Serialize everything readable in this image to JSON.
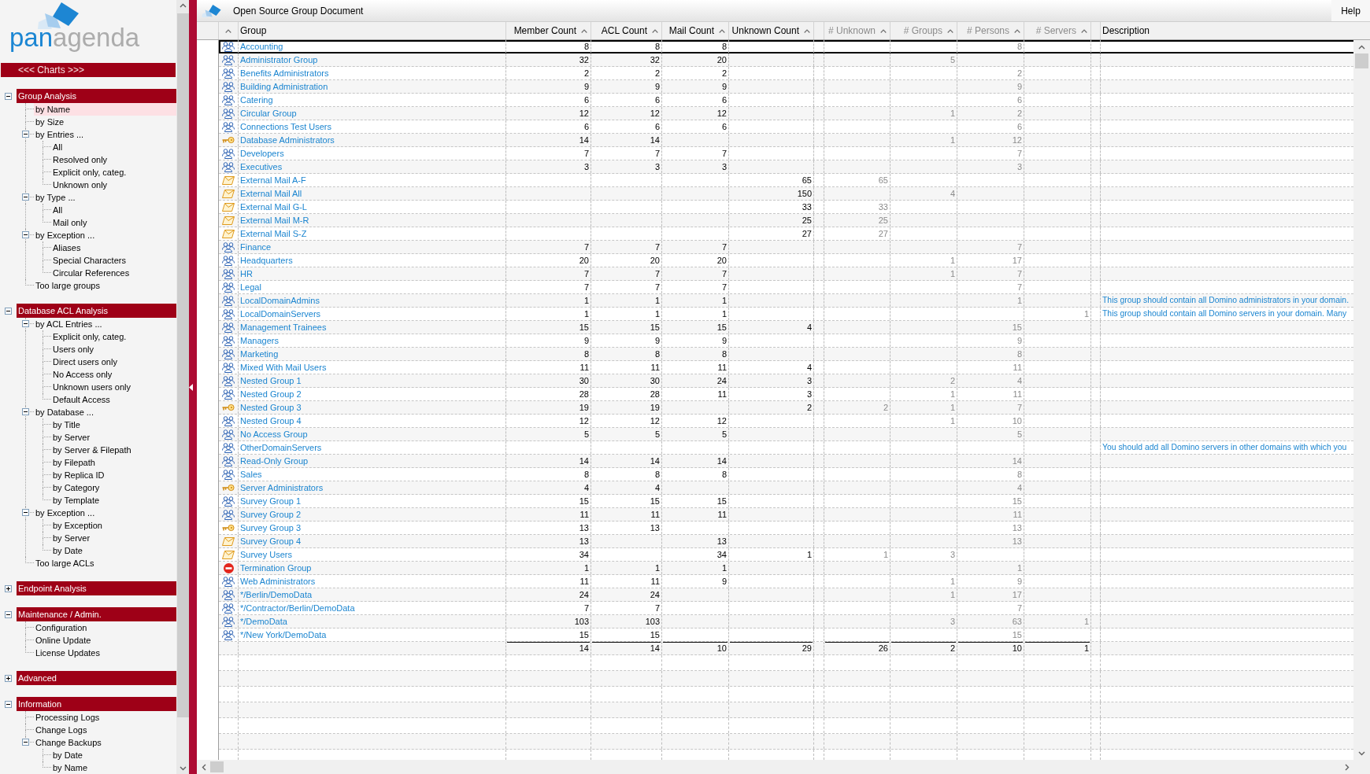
{
  "sidebar": {
    "logo": {
      "parts": [
        {
          "text": "pan",
          "color": "#1b86d3"
        },
        {
          "text": "agenda",
          "color": "#acacac"
        }
      ]
    },
    "charts_button": "<<< Charts >>>",
    "sections": [
      {
        "title": "Group Analysis",
        "expanded": true,
        "items": [
          {
            "label": "by Name",
            "selected": true
          },
          {
            "label": "by Size",
            "selected": false
          },
          {
            "label": "by Entries ...",
            "selected": false,
            "expanded": true,
            "children": [
              {
                "label": "All",
                "selected": false
              },
              {
                "label": "Resolved only",
                "selected": false
              },
              {
                "label": "Explicit only, categ.",
                "selected": false
              },
              {
                "label": "Unknown only",
                "selected": false
              }
            ]
          },
          {
            "label": "by Type ...",
            "selected": false,
            "expanded": true,
            "children": [
              {
                "label": "All",
                "selected": false
              },
              {
                "label": "Mail only",
                "selected": false
              }
            ]
          },
          {
            "label": "by Exception ...",
            "selected": false,
            "expanded": true,
            "children": [
              {
                "label": "Aliases",
                "selected": false
              },
              {
                "label": "Special Characters",
                "selected": false
              },
              {
                "label": "Circular References",
                "selected": false
              }
            ]
          },
          {
            "label": "Too large groups",
            "selected": false
          }
        ]
      },
      {
        "title": "Database ACL Analysis",
        "expanded": true,
        "items": [
          {
            "label": "by ACL Entries ...",
            "selected": false,
            "expanded": true,
            "children": [
              {
                "label": "Explicit only, categ.",
                "selected": false
              },
              {
                "label": "Users only",
                "selected": false
              },
              {
                "label": "Direct users only",
                "selected": false
              },
              {
                "label": "No Access only",
                "selected": false
              },
              {
                "label": "Unknown users only",
                "selected": false
              },
              {
                "label": "Default Access",
                "selected": false
              }
            ]
          },
          {
            "label": "by Database ...",
            "selected": false,
            "expanded": true,
            "children": [
              {
                "label": "by Title",
                "selected": false
              },
              {
                "label": "by Server",
                "selected": false
              },
              {
                "label": "by Server & Filepath",
                "selected": false
              },
              {
                "label": "by Filepath",
                "selected": false
              },
              {
                "label": "by Replica ID",
                "selected": false
              },
              {
                "label": "by Category",
                "selected": false
              },
              {
                "label": "by Template",
                "selected": false
              }
            ]
          },
          {
            "label": "by Exception ...",
            "selected": false,
            "expanded": true,
            "children": [
              {
                "label": "by Exception",
                "selected": false
              },
              {
                "label": "by Server",
                "selected": false
              },
              {
                "label": "by Date",
                "selected": false
              }
            ]
          },
          {
            "label": "Too large ACLs",
            "selected": false
          }
        ]
      },
      {
        "title": "Endpoint Analysis",
        "expanded": false
      },
      {
        "title": "Maintenance / Admin.",
        "expanded": true,
        "items": [
          {
            "label": "Configuration",
            "selected": false
          },
          {
            "label": "Online Update",
            "selected": false
          },
          {
            "label": "License Updates",
            "selected": false
          }
        ]
      },
      {
        "title": "Advanced",
        "expanded": false
      },
      {
        "title": "Information",
        "expanded": true,
        "items": [
          {
            "label": "Processing Logs",
            "selected": false
          },
          {
            "label": "Change Logs",
            "selected": false
          },
          {
            "label": "Change Backups",
            "selected": false,
            "expanded": true,
            "children": [
              {
                "label": "by Date",
                "selected": false
              },
              {
                "label": "by Name",
                "selected": false
              }
            ]
          }
        ]
      }
    ]
  },
  "window": {
    "title": "Open Source Group Document",
    "help_button": "Help"
  },
  "table": {
    "columns": [
      {
        "kind": "icon",
        "sortable": true
      },
      {
        "kind": "name",
        "label": "Group",
        "sortable": false
      },
      {
        "kind": "count",
        "label": "Member Count",
        "sortable": true
      },
      {
        "kind": "count",
        "label": "ACL Count",
        "sortable": true
      },
      {
        "kind": "count",
        "label": "Mail Count",
        "sortable": true
      },
      {
        "kind": "count",
        "label": "Unknown Count",
        "sortable": true
      },
      {
        "kind": "count_muted",
        "label": "# Unknown",
        "sortable": true
      },
      {
        "kind": "count_muted",
        "label": "# Groups",
        "sortable": true
      },
      {
        "kind": "count_muted",
        "label": "# Persons",
        "sortable": true
      },
      {
        "kind": "count_muted",
        "label": "# Servers",
        "sortable": true
      },
      {
        "kind": "text",
        "label": "Description",
        "sortable": false
      }
    ],
    "rows": [
      {
        "kind": "multi_purpose",
        "name": "Accounting",
        "member_count": "8",
        "acl_count": "8",
        "mail_count": "8",
        "persons": "8",
        "selected": true
      },
      {
        "kind": "multi_purpose",
        "name": "Administrator Group",
        "member_count": "32",
        "acl_count": "32",
        "mail_count": "20",
        "groups": "5",
        "selected": false
      },
      {
        "kind": "multi_purpose",
        "name": "Benefits Administrators",
        "member_count": "2",
        "acl_count": "2",
        "mail_count": "2",
        "persons": "2",
        "selected": false
      },
      {
        "kind": "multi_purpose",
        "name": "Building Administration",
        "member_count": "9",
        "acl_count": "9",
        "mail_count": "9",
        "persons": "9",
        "selected": false
      },
      {
        "kind": "multi_purpose",
        "name": "Catering",
        "member_count": "6",
        "acl_count": "6",
        "mail_count": "6",
        "persons": "6",
        "selected": false
      },
      {
        "kind": "multi_purpose",
        "name": "Circular Group",
        "member_count": "12",
        "acl_count": "12",
        "mail_count": "12",
        "groups": "1",
        "persons": "2",
        "selected": false
      },
      {
        "kind": "multi_purpose",
        "name": "Connections Test Users",
        "member_count": "6",
        "acl_count": "6",
        "mail_count": "6",
        "persons": "6",
        "selected": false
      },
      {
        "kind": "acl_only",
        "name": "Database Administrators",
        "member_count": "14",
        "acl_count": "14",
        "groups": "1",
        "persons": "12",
        "selected": false
      },
      {
        "kind": "multi_purpose",
        "name": "Developers",
        "member_count": "7",
        "acl_count": "7",
        "mail_count": "7",
        "persons": "7",
        "selected": false
      },
      {
        "kind": "multi_purpose",
        "name": "Executives",
        "member_count": "3",
        "acl_count": "3",
        "mail_count": "3",
        "persons": "3",
        "selected": false
      },
      {
        "kind": "mail_only",
        "name": "External Mail A-F",
        "unknown_count": "65",
        "unknown": "65",
        "selected": false
      },
      {
        "kind": "mail_only",
        "name": "External Mail All",
        "unknown_count": "150",
        "groups": "4",
        "selected": false
      },
      {
        "kind": "mail_only",
        "name": "External Mail G-L",
        "unknown_count": "33",
        "unknown": "33",
        "selected": false
      },
      {
        "kind": "mail_only",
        "name": "External Mail M-R",
        "unknown_count": "25",
        "unknown": "25",
        "selected": false
      },
      {
        "kind": "mail_only",
        "name": "External Mail S-Z",
        "unknown_count": "27",
        "unknown": "27",
        "selected": false
      },
      {
        "kind": "multi_purpose",
        "name": "Finance",
        "member_count": "7",
        "acl_count": "7",
        "mail_count": "7",
        "persons": "7",
        "selected": false
      },
      {
        "kind": "multi_purpose",
        "name": "Headquarters",
        "member_count": "20",
        "acl_count": "20",
        "mail_count": "20",
        "groups": "1",
        "persons": "17",
        "selected": false
      },
      {
        "kind": "multi_purpose",
        "name": "HR",
        "member_count": "7",
        "acl_count": "7",
        "mail_count": "7",
        "groups": "1",
        "persons": "7",
        "selected": false
      },
      {
        "kind": "multi_purpose",
        "name": "Legal",
        "member_count": "7",
        "acl_count": "7",
        "mail_count": "7",
        "persons": "7",
        "selected": false
      },
      {
        "kind": "multi_purpose",
        "name": "LocalDomainAdmins",
        "member_count": "1",
        "acl_count": "1",
        "mail_count": "1",
        "persons": "1",
        "description": "This group should contain all Domino administrators in your domain.",
        "selected": false
      },
      {
        "kind": "multi_purpose",
        "name": "LocalDomainServers",
        "member_count": "1",
        "acl_count": "1",
        "mail_count": "1",
        "servers": "1",
        "description": "This group should contain all Domino servers in your domain. Many",
        "selected": false
      },
      {
        "kind": "multi_purpose",
        "name": "Management Trainees",
        "member_count": "15",
        "acl_count": "15",
        "mail_count": "15",
        "unknown_count": "4",
        "persons": "15",
        "selected": false
      },
      {
        "kind": "multi_purpose",
        "name": "Managers",
        "member_count": "9",
        "acl_count": "9",
        "mail_count": "9",
        "persons": "9",
        "selected": false
      },
      {
        "kind": "multi_purpose",
        "name": "Marketing",
        "member_count": "8",
        "acl_count": "8",
        "mail_count": "8",
        "persons": "8",
        "selected": false
      },
      {
        "kind": "multi_purpose",
        "name": "Mixed With Mail Users",
        "member_count": "11",
        "acl_count": "11",
        "mail_count": "11",
        "unknown_count": "4",
        "persons": "11",
        "selected": false
      },
      {
        "kind": "multi_purpose",
        "name": "Nested Group 1",
        "member_count": "30",
        "acl_count": "30",
        "mail_count": "24",
        "unknown_count": "3",
        "groups": "2",
        "persons": "4",
        "selected": false
      },
      {
        "kind": "multi_purpose",
        "name": "Nested Group 2",
        "member_count": "28",
        "acl_count": "28",
        "mail_count": "11",
        "unknown_count": "3",
        "groups": "1",
        "persons": "11",
        "selected": false
      },
      {
        "kind": "acl_only",
        "name": "Nested Group 3",
        "member_count": "19",
        "acl_count": "19",
        "unknown_count": "2",
        "unknown": "2",
        "groups": "1",
        "persons": "7",
        "selected": false
      },
      {
        "kind": "multi_purpose",
        "name": "Nested Group 4",
        "member_count": "12",
        "acl_count": "12",
        "mail_count": "12",
        "groups": "1",
        "persons": "10",
        "selected": false
      },
      {
        "kind": "multi_purpose",
        "name": "No Access Group",
        "member_count": "5",
        "acl_count": "5",
        "mail_count": "5",
        "persons": "5",
        "selected": false
      },
      {
        "kind": "multi_purpose",
        "name": "OtherDomainServers",
        "description": "You should add all Domino servers in other domains with which you",
        "selected": false
      },
      {
        "kind": "multi_purpose",
        "name": "Read-Only Group",
        "member_count": "14",
        "acl_count": "14",
        "mail_count": "14",
        "persons": "14",
        "selected": false
      },
      {
        "kind": "multi_purpose",
        "name": "Sales",
        "member_count": "8",
        "acl_count": "8",
        "mail_count": "8",
        "persons": "8",
        "selected": false
      },
      {
        "kind": "acl_only",
        "name": "Server Administrators",
        "member_count": "4",
        "acl_count": "4",
        "persons": "4",
        "selected": false
      },
      {
        "kind": "multi_purpose",
        "name": "Survey Group 1",
        "member_count": "15",
        "acl_count": "15",
        "mail_count": "15",
        "persons": "15",
        "selected": false
      },
      {
        "kind": "multi_purpose",
        "name": "Survey Group 2",
        "member_count": "11",
        "acl_count": "11",
        "mail_count": "11",
        "persons": "11",
        "selected": false
      },
      {
        "kind": "acl_only",
        "name": "Survey Group 3",
        "member_count": "13",
        "acl_count": "13",
        "persons": "13",
        "selected": false
      },
      {
        "kind": "mail_only",
        "name": "Survey Group 4",
        "member_count": "13",
        "mail_count": "13",
        "persons": "13",
        "selected": false
      },
      {
        "kind": "mail_only",
        "name": "Survey Users",
        "member_count": "34",
        "mail_count": "34",
        "unknown_count": "1",
        "unknown": "1",
        "groups": "3",
        "selected": false
      },
      {
        "kind": "deny_list",
        "name": "Termination Group",
        "member_count": "1",
        "acl_count": "1",
        "mail_count": "1",
        "persons": "1",
        "selected": false
      },
      {
        "kind": "multi_purpose",
        "name": "Web Administrators",
        "member_count": "11",
        "acl_count": "11",
        "mail_count": "9",
        "groups": "1",
        "persons": "9",
        "selected": false
      },
      {
        "kind": "multi_purpose",
        "name": "*/Berlin/DemoData",
        "member_count": "24",
        "acl_count": "24",
        "groups": "1",
        "persons": "17",
        "selected": false
      },
      {
        "kind": "multi_purpose",
        "name": "*/Contractor/Berlin/DemoData",
        "member_count": "7",
        "acl_count": "7",
        "persons": "7",
        "selected": false
      },
      {
        "kind": "multi_purpose",
        "name": "*/DemoData",
        "member_count": "103",
        "acl_count": "103",
        "groups": "3",
        "persons": "63",
        "servers": "1",
        "selected": false
      },
      {
        "kind": "multi_purpose",
        "name": "*/New York/DemoData",
        "member_count": "15",
        "acl_count": "15",
        "persons": "15",
        "selected": false
      }
    ],
    "totals": {
      "member_count": "14",
      "acl_count": "14",
      "mail_count": "10",
      "unknown_count": "29",
      "unknown": "26",
      "groups": "2",
      "persons": "10",
      "servers": "1"
    }
  }
}
